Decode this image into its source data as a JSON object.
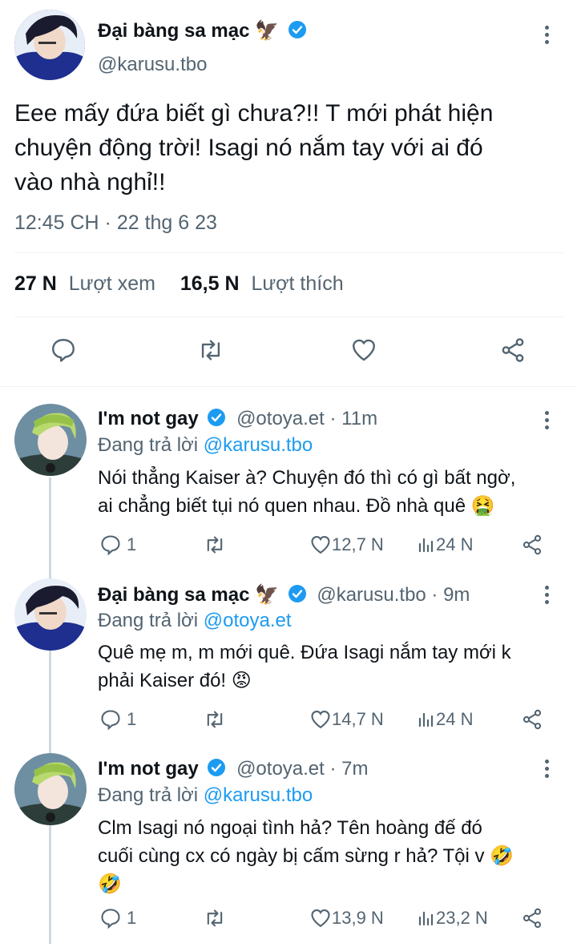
{
  "main_tweet": {
    "author_name": "Đại bàng sa mạc",
    "author_emoji": "🦅",
    "handle": "@karusu.tbo",
    "text_lines": [
      "Eee mấy đứa biết gì chưa?!! T mới phát hiện",
      "chuyện động trời! Isagi nó nắm tay với ai đó",
      "vào nhà nghỉ!!"
    ],
    "timestamp": "12:45 CH · 22 thg 6 23",
    "views_count": "27 N",
    "views_label": "Lượt xem",
    "likes_count": "16,5 N",
    "likes_label": "Lượt thích"
  },
  "replies": [
    {
      "author_name": "I'm not gay",
      "handle_time": "@otoya.et · 11m",
      "replying_prefix": "Đang trả lời",
      "replying_to": "@karusu.tbo",
      "text_lines": [
        "Nói thẳng Kaiser à? Chuyện đó thì có gì bất ngờ,",
        "ai chẳng biết tụi nó quen nhau. Đồ nhà quê 🤮"
      ],
      "reply_count": "1",
      "like_count": "12,7 N",
      "view_count": "24 N"
    },
    {
      "author_name": "Đại bàng sa mạc",
      "author_emoji": "🦅",
      "handle_time": "@karusu.tbo · 9m",
      "replying_prefix": "Đang trả lời",
      "replying_to": "@otoya.et",
      "text_lines": [
        "Quê mẹ m, m mới quê. Đứa Isagi nắm tay mới k",
        "phải Kaiser đó! 😡"
      ],
      "reply_count": "1",
      "like_count": "14,7 N",
      "view_count": "24 N"
    },
    {
      "author_name": "I'm not gay",
      "handle_time": "@otoya.et · 7m",
      "replying_prefix": "Đang trả lời",
      "replying_to": "@karusu.tbo",
      "text_lines": [
        "Clm Isagi nó ngoại tình hả? Tên hoàng đế đó",
        "cuối cùng cx có ngày bị cấm sừng r hả? Tội v 🤣",
        "🤣"
      ],
      "reply_count": "1",
      "like_count": "13,9 N",
      "view_count": "23,2 N"
    }
  ],
  "colors": {
    "accent": "#1d9bf0",
    "secondary_text": "#536471",
    "divider": "#eff3f4",
    "thread_line": "#cfd9de"
  }
}
